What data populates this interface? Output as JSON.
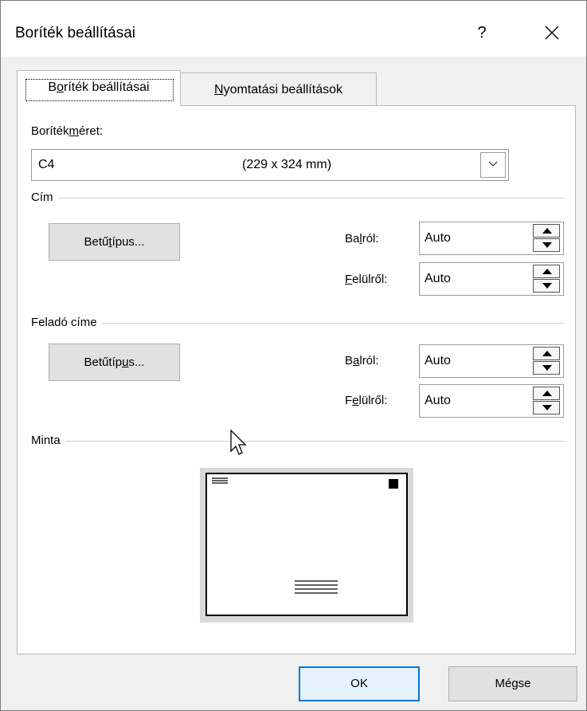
{
  "window": {
    "title": "Boríték beállításai",
    "help_glyph": "?",
    "close_glyph": "✕"
  },
  "tabs": [
    {
      "pre": "B",
      "mnemonic": "o",
      "post": "ríték beállításai",
      "active": true
    },
    {
      "pre": "",
      "mnemonic": "N",
      "post": "yomtatási beállítások",
      "active": false
    }
  ],
  "envelope_size": {
    "label_pre": "Boríték",
    "label_mnemonic": "m",
    "label_post": "éret:",
    "value": "C4",
    "dimensions": "(229 x 324 mm)"
  },
  "address": {
    "group_label": "Cím",
    "font_button": {
      "pre": "Betű",
      "mnemonic": "t",
      "post": "ípus..."
    },
    "from_left": {
      "pre": "Ba",
      "mnemonic": "l",
      "post": "ról:",
      "value": "Auto"
    },
    "from_top": {
      "pre": "",
      "mnemonic": "F",
      "post": "elülről:",
      "value": "Auto"
    }
  },
  "return_address": {
    "group_label": "Feladó címe",
    "font_button": {
      "pre": "Betűtíp",
      "mnemonic": "u",
      "post": "s..."
    },
    "from_left": {
      "pre": "B",
      "mnemonic": "a",
      "post": "lról:",
      "value": "Auto"
    },
    "from_top": {
      "pre": "F",
      "mnemonic": "e",
      "post": "lülről:",
      "value": "Auto"
    }
  },
  "preview": {
    "group_label": "Minta"
  },
  "buttons": {
    "ok": "OK",
    "cancel": "Mégse"
  },
  "colors": {
    "accent": "#0078d7",
    "ok_bg": "#e5f1fb"
  }
}
